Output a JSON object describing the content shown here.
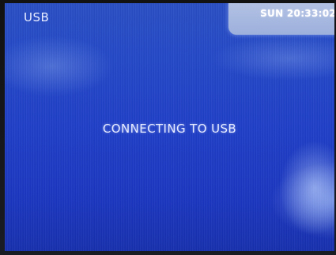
{
  "header": {
    "mode": "USB",
    "clock": "SUN 20:33:02"
  },
  "main": {
    "status_message": "CONNECTING TO USB"
  },
  "colors": {
    "screen_background": "#1f3fc8",
    "clock_box": "#b3c2e4",
    "text": "#e6ebff"
  }
}
